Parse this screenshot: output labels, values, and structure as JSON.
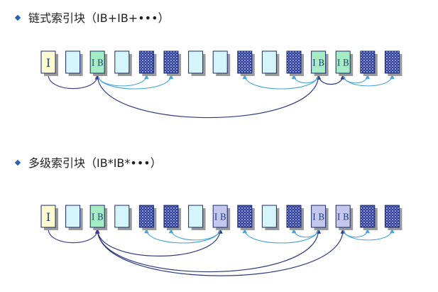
{
  "sections": [
    {
      "id": "linked",
      "heading": "链式索引块（IB+IB+•••）",
      "blocks": [
        {
          "kind": "index-node",
          "label": "I"
        },
        {
          "kind": "empty"
        },
        {
          "kind": "index-block",
          "label": "IB"
        },
        {
          "kind": "empty"
        },
        {
          "kind": "data"
        },
        {
          "kind": "data"
        },
        {
          "kind": "empty"
        },
        {
          "kind": "empty"
        },
        {
          "kind": "data"
        },
        {
          "kind": "empty"
        },
        {
          "kind": "data"
        },
        {
          "kind": "index-block",
          "label": "IB"
        },
        {
          "kind": "index-block",
          "label": "IB"
        },
        {
          "kind": "data"
        },
        {
          "kind": "data"
        }
      ],
      "links": [
        {
          "from": 0,
          "to": 2,
          "style": "pointer"
        },
        {
          "from": 2,
          "to": 4,
          "style": "index"
        },
        {
          "from": 2,
          "to": 5,
          "style": "index"
        },
        {
          "from": 2,
          "to": 11,
          "style": "chain"
        },
        {
          "from": 11,
          "to": 8,
          "style": "index"
        },
        {
          "from": 11,
          "to": 10,
          "style": "index"
        },
        {
          "from": 11,
          "to": 12,
          "style": "chain"
        },
        {
          "from": 12,
          "to": 13,
          "style": "index"
        },
        {
          "from": 12,
          "to": 14,
          "style": "index"
        }
      ]
    },
    {
      "id": "multilevel",
      "heading": "多级索引块（IB*IB*•••）",
      "blocks": [
        {
          "kind": "index-node",
          "label": "I"
        },
        {
          "kind": "empty"
        },
        {
          "kind": "index-block",
          "label": "IB"
        },
        {
          "kind": "empty"
        },
        {
          "kind": "data"
        },
        {
          "kind": "data"
        },
        {
          "kind": "empty"
        },
        {
          "kind": "sub-index",
          "label": "IB"
        },
        {
          "kind": "data"
        },
        {
          "kind": "empty"
        },
        {
          "kind": "data"
        },
        {
          "kind": "sub-index",
          "label": "IB"
        },
        {
          "kind": "sub-index",
          "label": "IB"
        },
        {
          "kind": "data"
        },
        {
          "kind": "data"
        }
      ],
      "links": [
        {
          "from": 0,
          "to": 2,
          "style": "pointer"
        },
        {
          "from": 2,
          "to": 7,
          "style": "chain"
        },
        {
          "from": 2,
          "to": 11,
          "style": "chain"
        },
        {
          "from": 2,
          "to": 12,
          "style": "chain"
        },
        {
          "from": 7,
          "to": 4,
          "style": "index"
        },
        {
          "from": 7,
          "to": 5,
          "style": "index"
        },
        {
          "from": 11,
          "to": 8,
          "style": "index"
        },
        {
          "from": 11,
          "to": 10,
          "style": "index"
        },
        {
          "from": 12,
          "to": 13,
          "style": "index"
        },
        {
          "from": 12,
          "to": 14,
          "style": "index"
        }
      ]
    }
  ],
  "colors": {
    "bullet": "#2f5fb0",
    "index_node_fill": "#fffad0",
    "index_block_fill": "#a6ecc4",
    "sub_index_fill": "#c4c8ef",
    "empty_fill": "#d4f5fb",
    "data_fill": "#2b3b94",
    "data_dot": "#d8e2ff",
    "border": "#1a2a6e",
    "pointer_line": "#4a3f8f",
    "chain_line": "#2e3a80",
    "index_line": "#4aa6d6"
  }
}
